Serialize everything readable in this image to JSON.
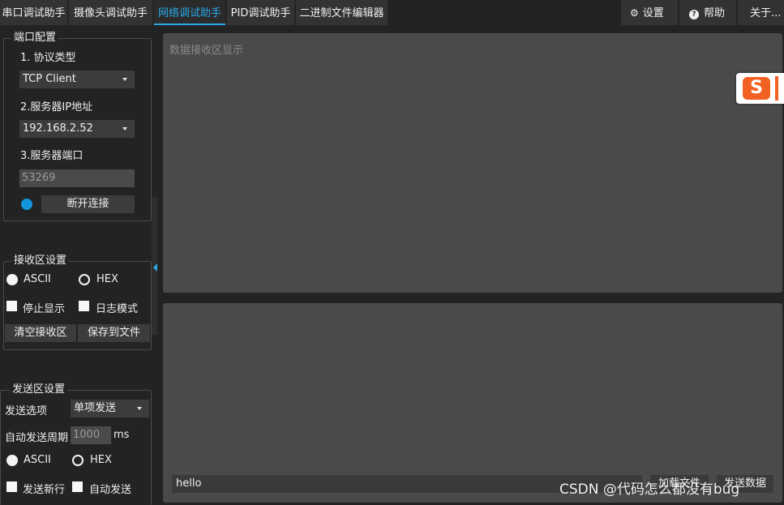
{
  "tabs": [
    {
      "label": "串口调试助手"
    },
    {
      "label": "摄像头调试助手"
    },
    {
      "label": "网络调试助手"
    },
    {
      "label": "PID调试助手"
    },
    {
      "label": "二进制文件编辑器"
    }
  ],
  "active_tab": "网络调试助手",
  "toolbar": {
    "settings_label": "设置",
    "help_label": "帮助",
    "about_label": "关于..."
  },
  "port_config": {
    "title": "端口配置",
    "protocol_label": "1. 协议类型",
    "protocol_value": "TCP Client",
    "server_ip_label": "2.服务器IP地址",
    "server_ip_value": "192.168.2.52",
    "server_port_label": "3.服务器端口",
    "server_port_value": "53269",
    "connect_button": "断开连接",
    "status_color": "#1296db"
  },
  "receive_settings": {
    "title": "接收区设置",
    "ascii_label": "ASCII",
    "hex_label": "HEX",
    "ascii_selected": true,
    "stop_display_label": "停止显示",
    "log_mode_label": "日志模式",
    "clear_button": "清空接收区",
    "save_button": "保存到文件"
  },
  "send_settings": {
    "title": "发送区设置",
    "send_option_label": "发送选项",
    "send_option_value": "单项发送",
    "auto_period_label": "自动发送周期",
    "auto_period_value": "1000",
    "auto_period_unit": "ms",
    "ascii_label": "ASCII",
    "hex_label": "HEX",
    "ascii_selected": true,
    "newline_label": "发送新行",
    "auto_send_label": "自动发送"
  },
  "receive_area": {
    "placeholder": "数据接收区显示"
  },
  "send_area": {
    "input_value": "hello",
    "load_file_button": "加载文件",
    "send_button": "发送数据"
  },
  "ime_logo_letter": "S",
  "watermark": "CSDN @代码怎么都没有bug",
  "colors": {
    "accent": "#2aa9e8",
    "background": "#232323",
    "panel": "#4a4a4a"
  }
}
